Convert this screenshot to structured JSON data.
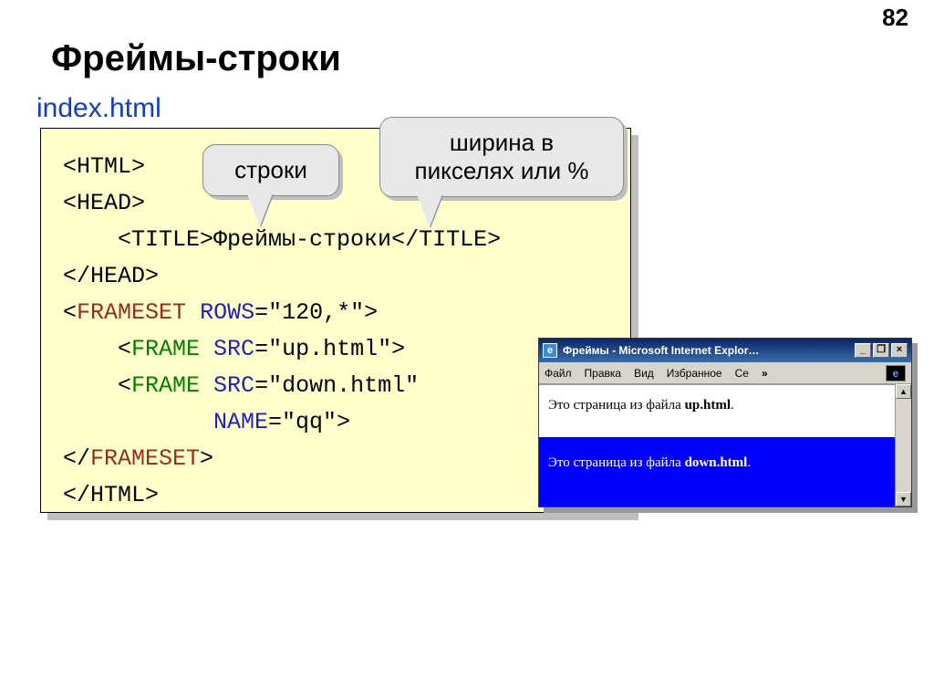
{
  "page_number": "82",
  "slide_title": "Фреймы-строки",
  "file_label": "index.html",
  "callouts": {
    "rows_label": "строки",
    "width_label": "ширина в пикселях или %"
  },
  "code": {
    "l1a": "<HTML>",
    "l2a": "<HEAD>",
    "l3a": "    <TITLE>",
    "l3b": "Фреймы-строки",
    "l3c": "</TITLE>",
    "l4a": "</HEAD>",
    "l5a": "<",
    "l5b": "FRAMESET",
    "l5c": " ",
    "l5d": "ROWS",
    "l5e": "=\"120,*\">",
    "l6a": "    <",
    "l6b": "FRAME",
    "l6c": " ",
    "l6d": "SRC",
    "l6e": "=\"up.html\">",
    "l7a": "    <",
    "l7b": "FRAME",
    "l7c": " ",
    "l7d": "SRC",
    "l7e": "=\"down.html\"",
    "l8a": "           ",
    "l8b": "NAME",
    "l8c": "=\"qq\">",
    "l9a": "</",
    "l9b": "FRAMESET",
    "l9c": ">",
    "l10a": "</HTML>"
  },
  "browser": {
    "title": "Фреймы - Microsoft Internet Explor…",
    "ie_icon": "e",
    "btn_min": "_",
    "btn_max": "❐",
    "btn_close": "×",
    "menu": {
      "file": "Файл",
      "edit": "Правка",
      "view": "Вид",
      "fav": "Избранное",
      "srv": "Се",
      "chev": "»",
      "logo": "e"
    },
    "frame_up_prefix": "Это страница из файла ",
    "frame_up_bold": "up.html",
    "frame_up_suffix": ".",
    "frame_down_prefix": "Это страница из файла ",
    "frame_down_bold": "down.html",
    "frame_down_suffix": ".",
    "scroll_up": "▲",
    "scroll_down": "▼"
  }
}
